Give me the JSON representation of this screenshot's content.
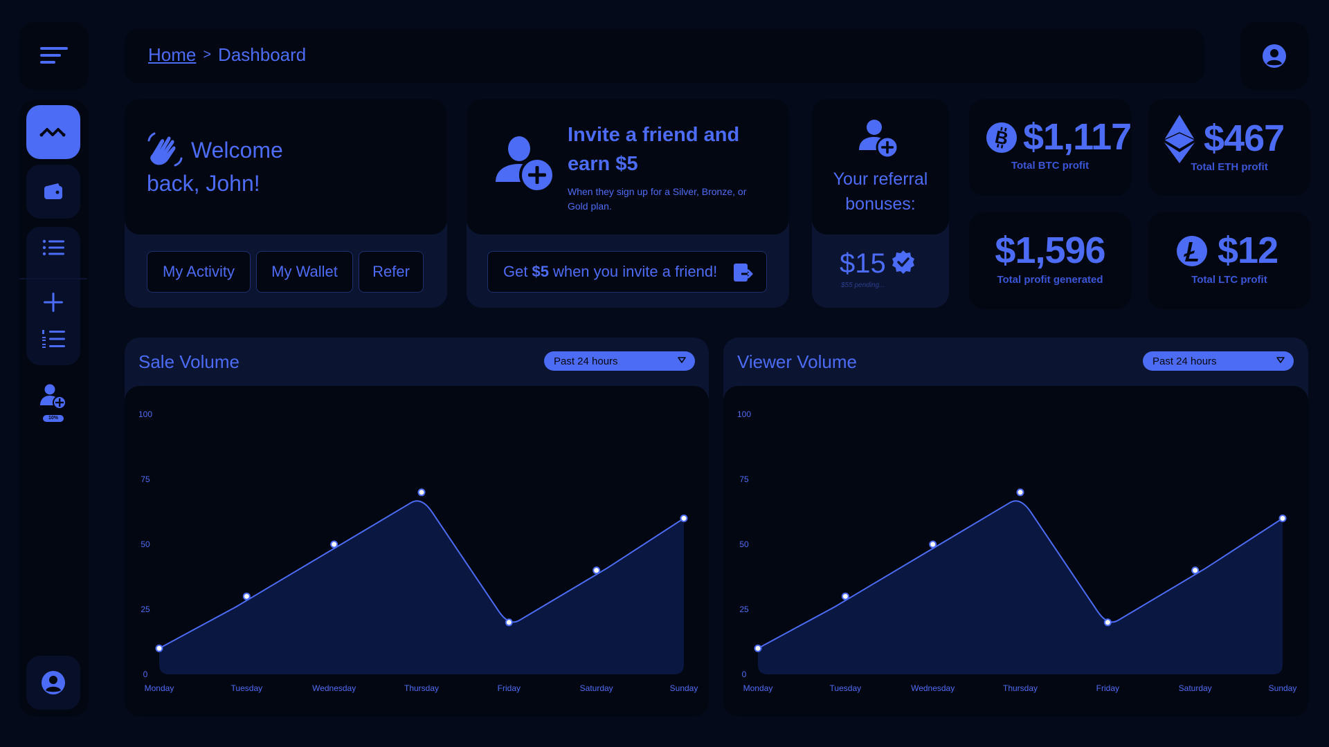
{
  "breadcrumb": {
    "home": "Home",
    "separator": ">",
    "current": "Dashboard"
  },
  "sidebar": {
    "items": [
      {
        "icon": "activity-icon",
        "active": true
      },
      {
        "icon": "wallet-icon"
      },
      {
        "icon": "list-icon"
      },
      {
        "icon": "plus-icon"
      },
      {
        "icon": "numbered-list-icon"
      },
      {
        "icon": "add-user-icon",
        "badge": "10%"
      }
    ]
  },
  "welcome": {
    "line1": "Welcome",
    "line2": "back, John!",
    "buttons": [
      "My Activity",
      "My Wallet",
      "Refer"
    ]
  },
  "invite": {
    "title_line1": "Invite a friend and",
    "title_line2": "earn $5",
    "subtitle_line1": "When they sign up for a Silver, Bronze, or",
    "subtitle_line2": "Gold plan.",
    "cta_prefix": "Get",
    "cta_bold": "$5",
    "cta_suffix": "when you invite a friend!"
  },
  "referral": {
    "title_line1": "Your referral",
    "title_line2": "bonuses:",
    "amount": "$15",
    "pending": "$55 pending..."
  },
  "stats": {
    "btc": {
      "value": "$1,117",
      "label": "Total BTC profit"
    },
    "eth": {
      "value": "$467",
      "label": "Total ETH profit"
    },
    "total": {
      "value": "$1,596",
      "label": "Total profit generated"
    },
    "ltc": {
      "value": "$12",
      "label": "Total LTC profit"
    }
  },
  "colors": {
    "accent": "#4d6cf5",
    "background": "#050a1b",
    "panel": "#030712",
    "panel_dim": "#0b1430"
  },
  "chart_data": [
    {
      "type": "area",
      "title": "Sale Volume",
      "range_label": "Past 24 hours",
      "categories": [
        "Monday",
        "Tuesday",
        "Wednesday",
        "Thursday",
        "Friday",
        "Saturday",
        "Sunday"
      ],
      "values": [
        10,
        30,
        50,
        70,
        20,
        40,
        60
      ],
      "yticks": [
        0,
        25,
        50,
        75,
        100
      ],
      "ylim": [
        0,
        100
      ]
    },
    {
      "type": "area",
      "title": "Viewer Volume",
      "range_label": "Past 24 hours",
      "categories": [
        "Monday",
        "Tuesday",
        "Wednesday",
        "Thursday",
        "Friday",
        "Saturday",
        "Sunday"
      ],
      "values": [
        10,
        30,
        50,
        70,
        20,
        40,
        60
      ],
      "yticks": [
        0,
        25,
        50,
        75,
        100
      ],
      "ylim": [
        0,
        100
      ]
    }
  ]
}
